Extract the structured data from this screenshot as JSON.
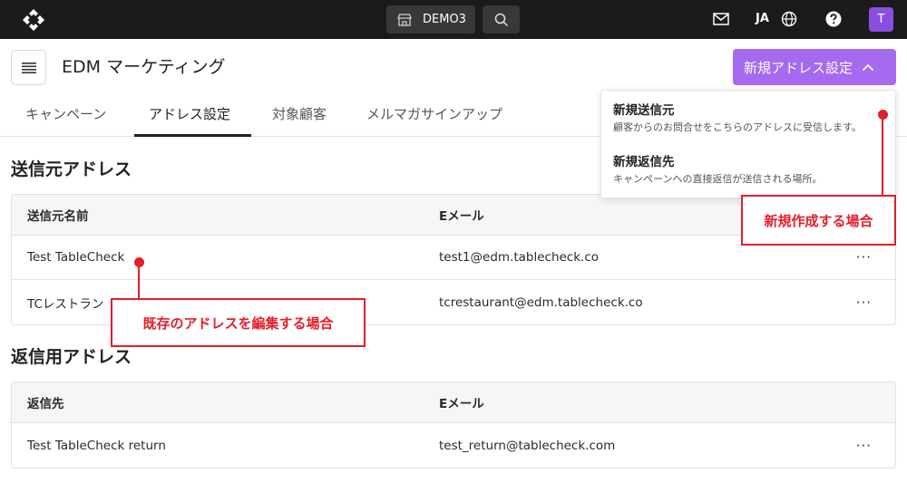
{
  "topbar": {
    "store_label": "DEMO3",
    "language": "JA",
    "avatar_initial": "T"
  },
  "header": {
    "title": "EDM マーケティング",
    "new_address_button": "新規アドレス設定"
  },
  "tabs": [
    {
      "label": "キャンペーン"
    },
    {
      "label": "アドレス設定"
    },
    {
      "label": "対象顧客"
    },
    {
      "label": "メルマガサインアップ"
    }
  ],
  "sender_section": {
    "title": "送信元アドレス",
    "columns": [
      "送信元名前",
      "Eメール"
    ],
    "rows": [
      {
        "name": "Test TableCheck",
        "email": "test1@edm.tablecheck.co"
      },
      {
        "name": "TCレストラン",
        "email": "tcrestaurant@edm.tablecheck.co"
      }
    ]
  },
  "reply_section": {
    "title": "返信用アドレス",
    "columns": [
      "返信先",
      "Eメール"
    ],
    "rows": [
      {
        "name": "Test TableCheck return",
        "email": "test_return@tablecheck.com"
      }
    ]
  },
  "dropdown": {
    "items": [
      {
        "title": "新規送信元",
        "desc": "顧客からのお問合せをこちらのアドレスに受信します。"
      },
      {
        "title": "新規返信先",
        "desc": "キャンペーンへの直接返信が送信される場所。"
      }
    ]
  },
  "annotations": {
    "edit": "既存のアドレスを編集する場合",
    "create": "新規作成する場合"
  },
  "icons": {
    "more": "···"
  },
  "colors": {
    "topbar": "#1b1b1b",
    "accent": "#a56af0",
    "avatar": "#8b4fe0",
    "annotation": "#e51e28"
  }
}
